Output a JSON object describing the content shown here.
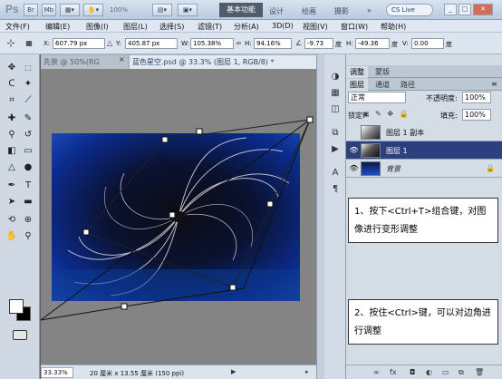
{
  "app": {
    "logo": "Ps",
    "zoom_display": "100%",
    "workspaces": [
      "基本功能",
      "设计",
      "绘画",
      "摄影"
    ],
    "active_workspace": "基本功能",
    "more": "»",
    "cs_live": "CS Live",
    "window_buttons": [
      "_",
      "□",
      "✕"
    ]
  },
  "menu": [
    "文件(F)",
    "编辑(E)",
    "图像(I)",
    "图层(L)",
    "选择(S)",
    "滤镜(T)",
    "分析(A)",
    "3D(D)",
    "视图(V)",
    "窗口(W)",
    "帮助(H)"
  ],
  "options": {
    "x_label": "X:",
    "x_value": "607.79 px",
    "y_label": "Y:",
    "y_value": "405.87 px",
    "w_label": "W:",
    "w_value": "105.38%",
    "h_label": "H:",
    "h_value": "94.16%",
    "angle_value": "-9.73",
    "angle_unit": "度",
    "hskew_label": "H:",
    "hskew_value": "-49.36",
    "hskew_unit": "度",
    "vskew_label": "V:",
    "vskew_value": "0.00",
    "vskew_unit": "度"
  },
  "tabs": [
    {
      "label": "先景 @ 50%(RG"
    },
    {
      "label": "蓝色星空.psd @ 33.3% (图层 1, RGB/8) *"
    }
  ],
  "tab_close": "×",
  "status": {
    "zoom": "33.33%",
    "doc_info": "20 厘米 x 13.55 厘米 (150 ppi)"
  },
  "layers_panel": {
    "tabs": [
      "调整",
      "蒙版"
    ],
    "tabs2": [
      "图层",
      "通道",
      "路径"
    ],
    "blend_mode": "正常",
    "opacity_label": "不透明度:",
    "opacity_value": "100%",
    "lock_label": "锁定:",
    "fill_label": "填充:",
    "fill_value": "100%",
    "layers": [
      {
        "name": "图层 1 副本",
        "visible": false,
        "selected": false
      },
      {
        "name": "图层 1",
        "visible": true,
        "selected": true
      },
      {
        "name": "背景",
        "visible": true,
        "selected": false,
        "locked": true
      }
    ]
  },
  "notes": [
    "1、按下<Ctrl+T>组合键，对图像进行变形调整",
    "2、按住<Ctrl>键，可以对边角进行调整"
  ],
  "colors": {
    "selected_layer": "#2d3f7c",
    "image_blue": "#1c4fc0"
  }
}
